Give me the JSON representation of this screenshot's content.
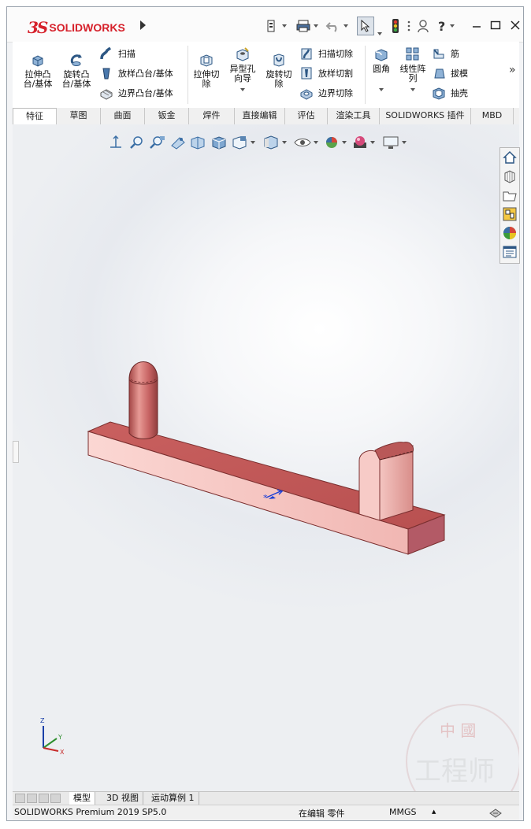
{
  "app": {
    "logo_mark": "3S",
    "logo_text": "SOLIDWORKS"
  },
  "ribbon": {
    "extrude_boss": "拉伸凸台/基体",
    "revolve_boss": "旋转凸台/基体",
    "sweep": "扫描",
    "loft_boss": "放样凸台/基体",
    "boundary_boss": "边界凸台/基体",
    "extrude_cut": "拉伸切除",
    "hole_wizard": "异型孔向导",
    "revolve_cut": "旋转切除",
    "swept_cut": "扫描切除",
    "lofted_cut": "放样切割",
    "boundary_cut": "边界切除",
    "fillet": "圆角",
    "linear_pattern": "线性阵列",
    "rib": "筋",
    "draft": "拔模",
    "shell": "抽壳",
    "more": "»"
  },
  "tabs": [
    "特征",
    "草图",
    "曲面",
    "钣金",
    "焊件",
    "直接编辑",
    "评估",
    "渲染工具",
    "SOLIDWORKS 插件",
    "MBD"
  ],
  "bottom_tabs": [
    "模型",
    "3D 视图",
    "运动算例 1"
  ],
  "status": {
    "product": "SOLIDWORKS Premium 2019 SP5.0",
    "mode": "在编辑 零件",
    "units": "MMGS",
    "units_arrow": "▲"
  },
  "triad": {
    "x": "X",
    "y": "Y",
    "z": "Z"
  },
  "watermark": {
    "line1": "中 國",
    "line2": "工程师"
  },
  "colors": {
    "part_top": "#c45a5a",
    "part_front": "#f7c9c6",
    "brand_red": "#d6212b"
  }
}
